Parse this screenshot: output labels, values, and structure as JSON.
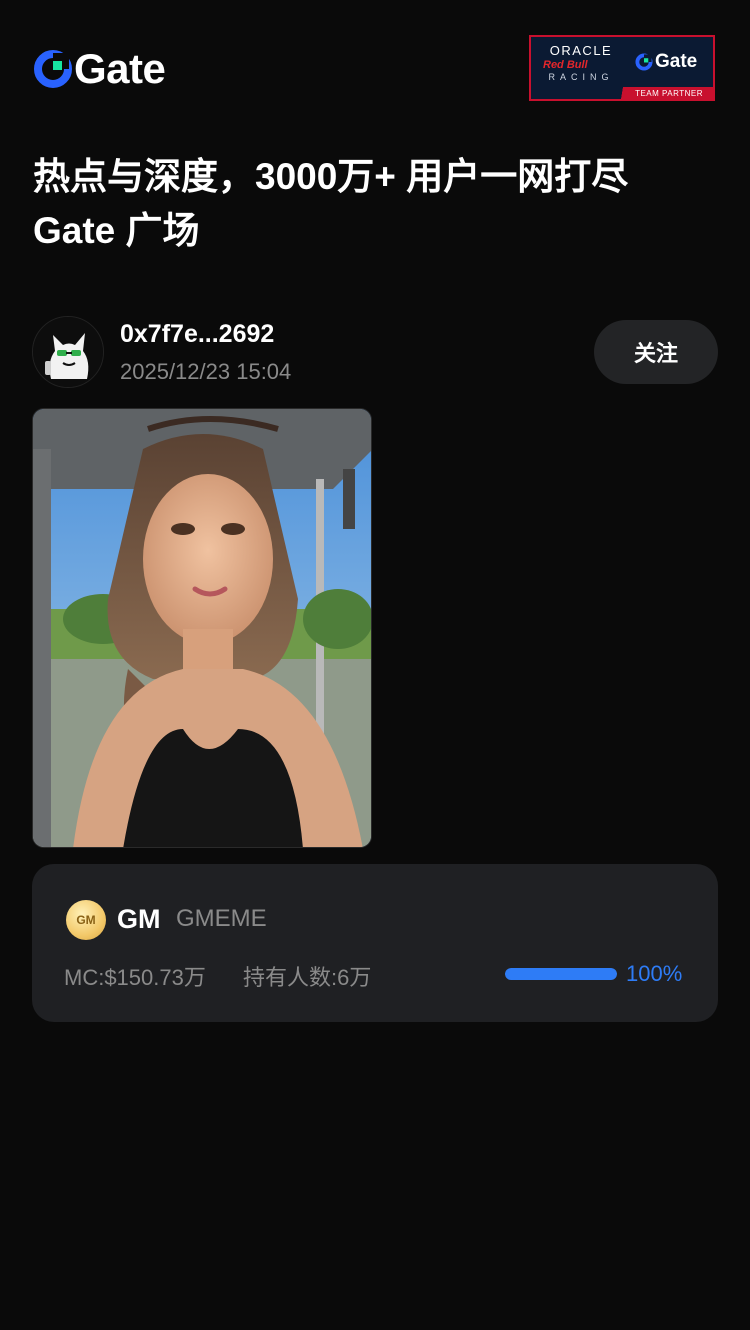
{
  "header": {
    "brand": "Gate",
    "partner": {
      "oracle": "ORACLE",
      "redbull": "Red Bull",
      "racing": "RACING",
      "gate": "Gate",
      "team_partner": "TEAM PARTNER"
    }
  },
  "headline": {
    "line1": "热点与深度，3000万+ 用户一网打尽",
    "line2": "Gate 广场"
  },
  "post": {
    "author": "0x7f7e...2692",
    "time": "2025/12/23 15:04",
    "follow_label": "关注"
  },
  "token": {
    "icon_text": "GM",
    "symbol": "GM",
    "name": "GMEME",
    "market_cap": "MC:$150.73万",
    "holders": "持有人数:6万",
    "progress_label": "100%",
    "progress_value": 1.0
  },
  "colors": {
    "background": "#0a0a0a",
    "card": "#1f2023",
    "accent_blue": "#2e7cf6",
    "brand_green": "#17e6a1"
  },
  "icons": [
    "gate-logo-icon",
    "avatar-cat-icon",
    "token-gm-icon"
  ]
}
